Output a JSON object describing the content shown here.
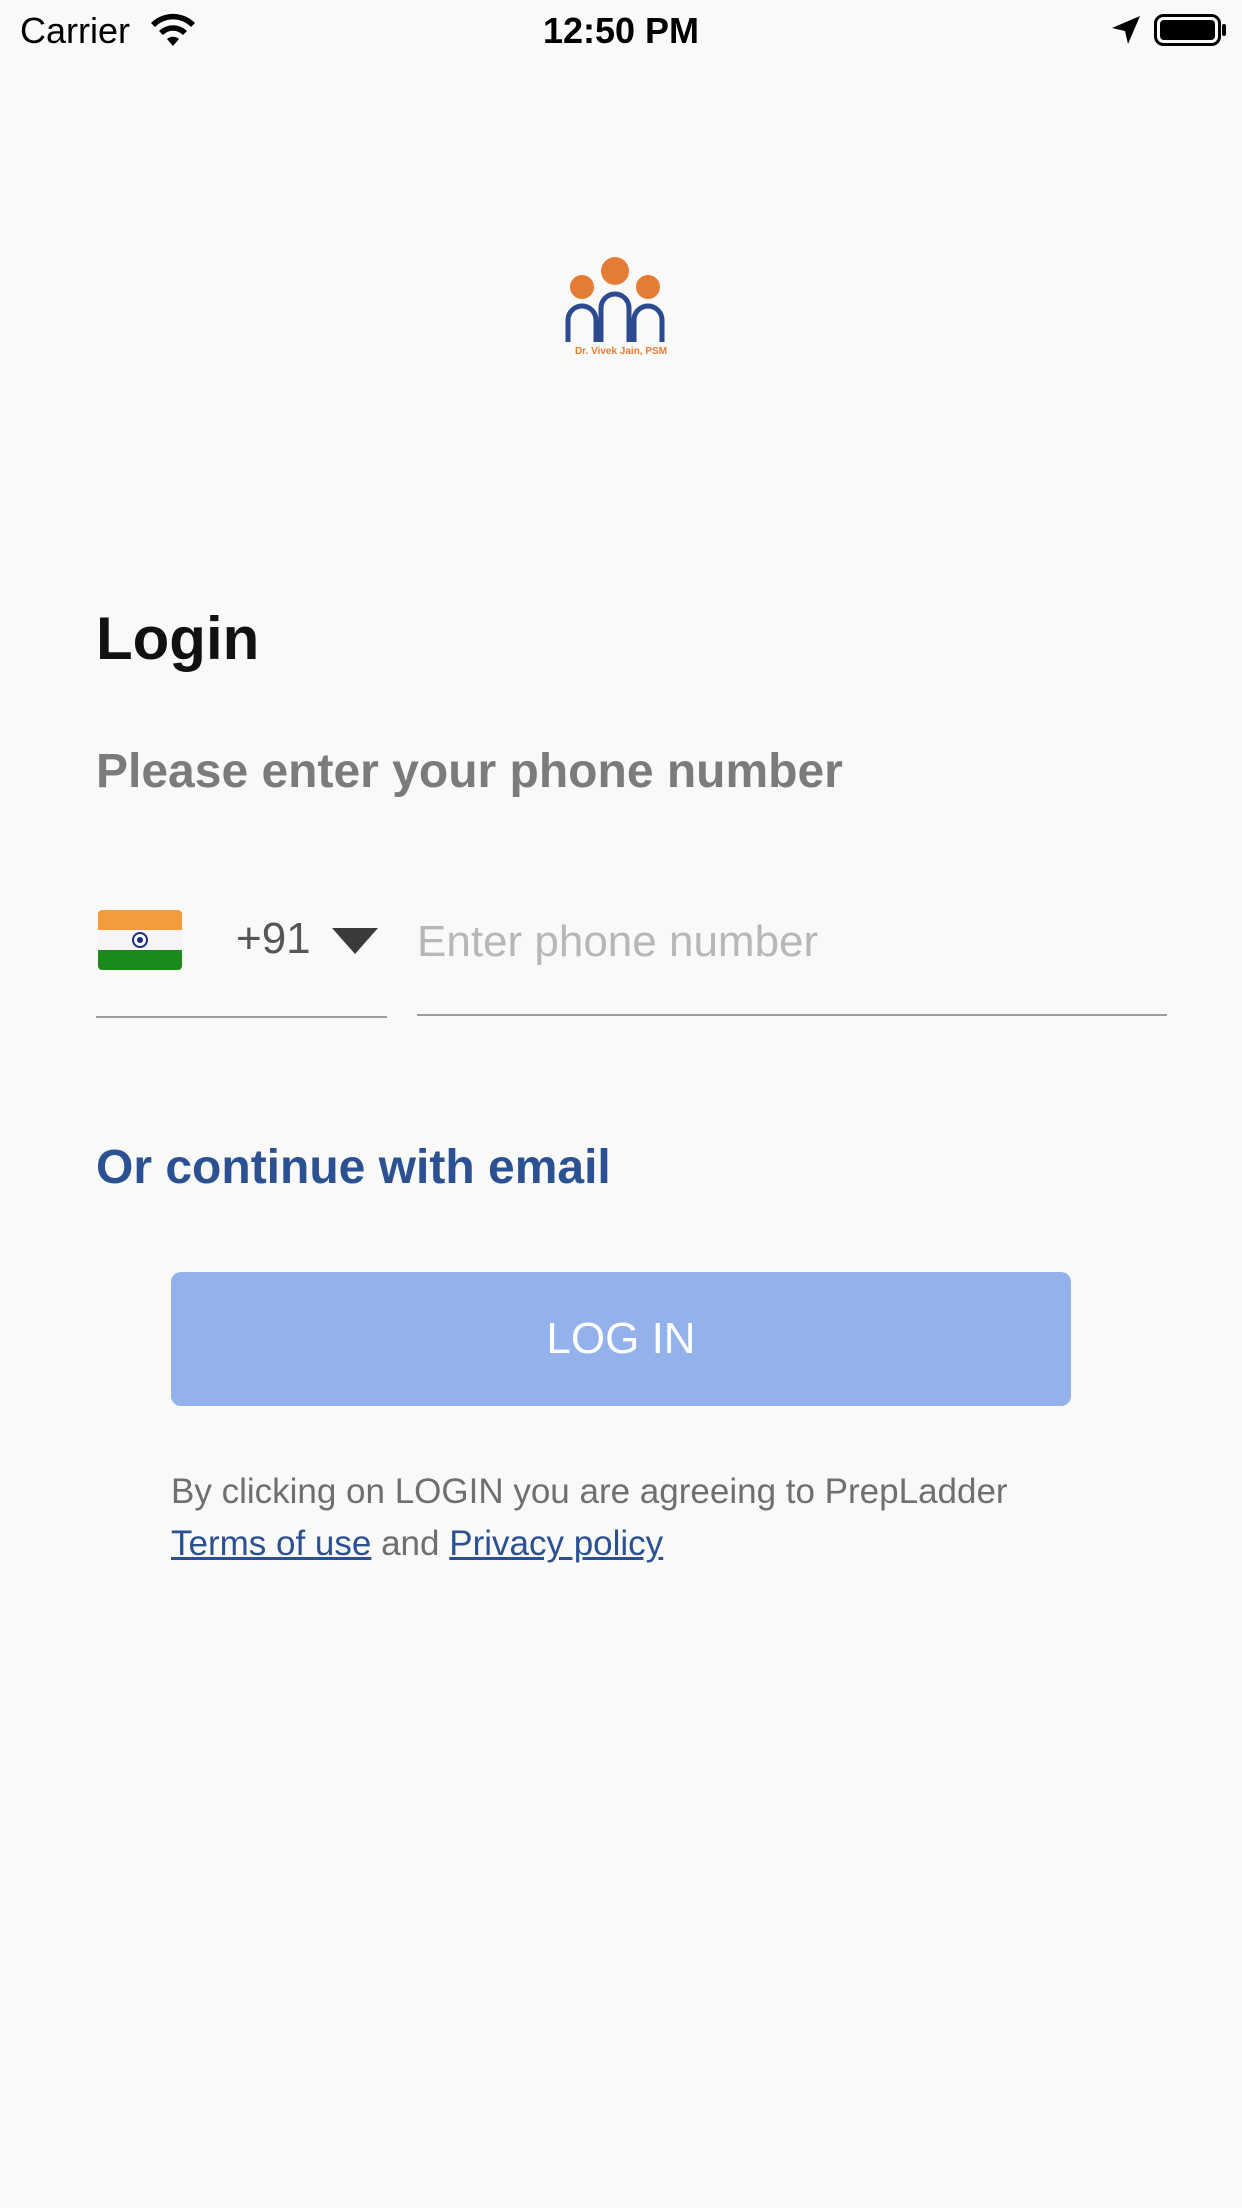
{
  "status_bar": {
    "carrier": "Carrier",
    "time": "12:50 PM",
    "icons": [
      "wifi-icon",
      "location-arrow-icon",
      "battery-icon"
    ]
  },
  "logo": {
    "caption": "Dr. Vivek Jain, PSM",
    "colors": {
      "heads": "#e57c36",
      "arches": "#2c4a8f"
    }
  },
  "login": {
    "title": "Login",
    "subtitle": "Please enter your phone number"
  },
  "phone": {
    "country_flag": "india-flag-icon",
    "dial_code": "+91",
    "placeholder": "Enter phone number",
    "value": ""
  },
  "email_link": "Or continue with email",
  "login_button": "LOG IN",
  "terms": {
    "prefix": "By clicking on LOGIN you are agreeing to PrepLadder",
    "terms_link": "Terms of use",
    "joiner": "and",
    "privacy_link": "Privacy policy"
  },
  "colors": {
    "background": "#f9f9f8",
    "accent": "#2c5192",
    "button": "#93b1eb",
    "muted_text": "#7b7b7b"
  }
}
